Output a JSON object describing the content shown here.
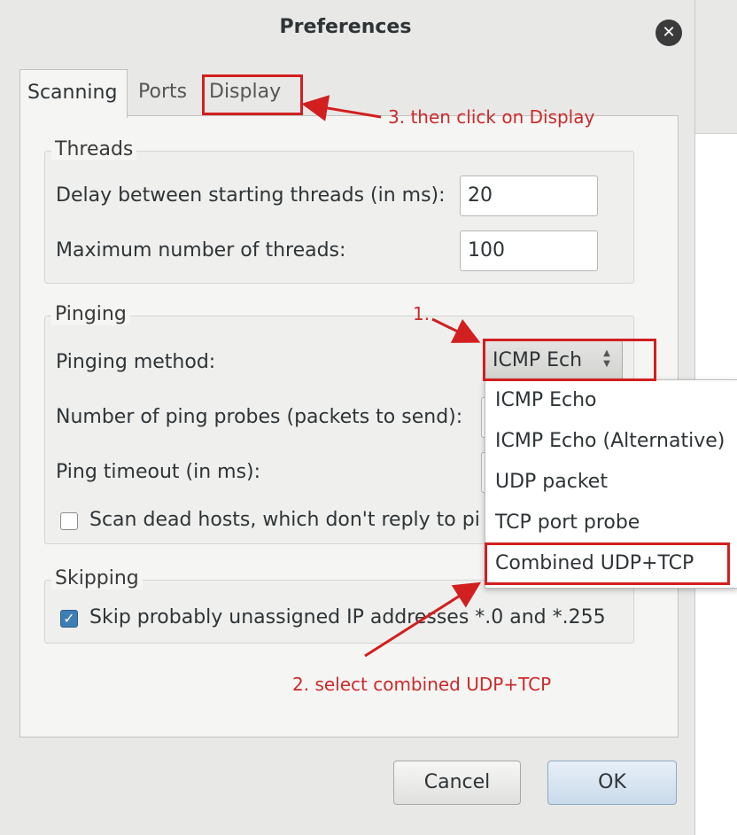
{
  "window": {
    "title": "Preferences"
  },
  "tabs": [
    {
      "label": "Scanning",
      "active": true
    },
    {
      "label": "Ports",
      "active": false
    },
    {
      "label": "Display",
      "active": false
    }
  ],
  "threads": {
    "group_label": "Threads",
    "delay_label": "Delay between starting threads (in ms):",
    "delay_value": "20",
    "max_label": "Maximum number of threads:",
    "max_value": "100"
  },
  "pinging": {
    "group_label": "Pinging",
    "method_label": "Pinging method:",
    "method_selected": "ICMP Ech",
    "probes_label": "Number of ping probes (packets to send):",
    "timeout_label": "Ping timeout (in ms):",
    "scan_dead_label": "Scan dead hosts, which don't reply to pi",
    "scan_dead_checked": false
  },
  "dropdown": {
    "options": [
      "ICMP Echo",
      "ICMP Echo (Alternative)",
      "UDP packet",
      "TCP port probe",
      "Combined UDP+TCP"
    ]
  },
  "skipping": {
    "group_label": "Skipping",
    "skip_label": "Skip probably unassigned IP addresses *.0 and *.255",
    "skip_checked": true
  },
  "buttons": {
    "cancel": "Cancel",
    "ok": "OK"
  },
  "annotations": {
    "step1": "1.",
    "step2": "2. select combined UDP+TCP",
    "step3": "3. then click on Display",
    "color": "#d21f1f"
  },
  "icons": {
    "close": "close-icon",
    "check": "check-icon",
    "combo_arrows": "up-down-arrows-icon"
  }
}
